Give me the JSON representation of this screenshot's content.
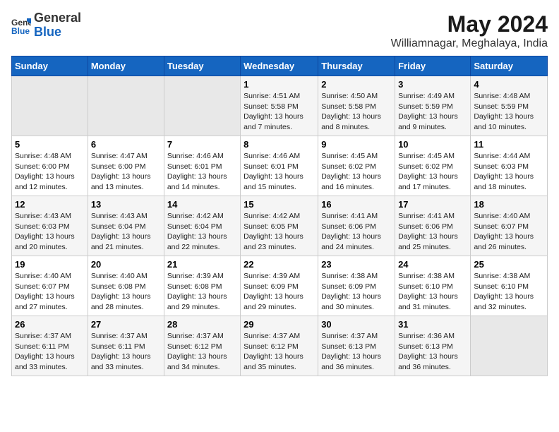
{
  "logo": {
    "text_general": "General",
    "text_blue": "Blue"
  },
  "title": "May 2024",
  "subtitle": "Williamnagar, Meghalaya, India",
  "days_of_week": [
    "Sunday",
    "Monday",
    "Tuesday",
    "Wednesday",
    "Thursday",
    "Friday",
    "Saturday"
  ],
  "weeks": [
    [
      {
        "day": "",
        "sunrise": "",
        "sunset": "",
        "daylight": "",
        "empty": true
      },
      {
        "day": "",
        "sunrise": "",
        "sunset": "",
        "daylight": "",
        "empty": true
      },
      {
        "day": "",
        "sunrise": "",
        "sunset": "",
        "daylight": "",
        "empty": true
      },
      {
        "day": "1",
        "sunrise": "Sunrise: 4:51 AM",
        "sunset": "Sunset: 5:58 PM",
        "daylight": "Daylight: 13 hours and 7 minutes."
      },
      {
        "day": "2",
        "sunrise": "Sunrise: 4:50 AM",
        "sunset": "Sunset: 5:58 PM",
        "daylight": "Daylight: 13 hours and 8 minutes."
      },
      {
        "day": "3",
        "sunrise": "Sunrise: 4:49 AM",
        "sunset": "Sunset: 5:59 PM",
        "daylight": "Daylight: 13 hours and 9 minutes."
      },
      {
        "day": "4",
        "sunrise": "Sunrise: 4:48 AM",
        "sunset": "Sunset: 5:59 PM",
        "daylight": "Daylight: 13 hours and 10 minutes."
      }
    ],
    [
      {
        "day": "5",
        "sunrise": "Sunrise: 4:48 AM",
        "sunset": "Sunset: 6:00 PM",
        "daylight": "Daylight: 13 hours and 12 minutes."
      },
      {
        "day": "6",
        "sunrise": "Sunrise: 4:47 AM",
        "sunset": "Sunset: 6:00 PM",
        "daylight": "Daylight: 13 hours and 13 minutes."
      },
      {
        "day": "7",
        "sunrise": "Sunrise: 4:46 AM",
        "sunset": "Sunset: 6:01 PM",
        "daylight": "Daylight: 13 hours and 14 minutes."
      },
      {
        "day": "8",
        "sunrise": "Sunrise: 4:46 AM",
        "sunset": "Sunset: 6:01 PM",
        "daylight": "Daylight: 13 hours and 15 minutes."
      },
      {
        "day": "9",
        "sunrise": "Sunrise: 4:45 AM",
        "sunset": "Sunset: 6:02 PM",
        "daylight": "Daylight: 13 hours and 16 minutes."
      },
      {
        "day": "10",
        "sunrise": "Sunrise: 4:45 AM",
        "sunset": "Sunset: 6:02 PM",
        "daylight": "Daylight: 13 hours and 17 minutes."
      },
      {
        "day": "11",
        "sunrise": "Sunrise: 4:44 AM",
        "sunset": "Sunset: 6:03 PM",
        "daylight": "Daylight: 13 hours and 18 minutes."
      }
    ],
    [
      {
        "day": "12",
        "sunrise": "Sunrise: 4:43 AM",
        "sunset": "Sunset: 6:03 PM",
        "daylight": "Daylight: 13 hours and 20 minutes."
      },
      {
        "day": "13",
        "sunrise": "Sunrise: 4:43 AM",
        "sunset": "Sunset: 6:04 PM",
        "daylight": "Daylight: 13 hours and 21 minutes."
      },
      {
        "day": "14",
        "sunrise": "Sunrise: 4:42 AM",
        "sunset": "Sunset: 6:04 PM",
        "daylight": "Daylight: 13 hours and 22 minutes."
      },
      {
        "day": "15",
        "sunrise": "Sunrise: 4:42 AM",
        "sunset": "Sunset: 6:05 PM",
        "daylight": "Daylight: 13 hours and 23 minutes."
      },
      {
        "day": "16",
        "sunrise": "Sunrise: 4:41 AM",
        "sunset": "Sunset: 6:06 PM",
        "daylight": "Daylight: 13 hours and 24 minutes."
      },
      {
        "day": "17",
        "sunrise": "Sunrise: 4:41 AM",
        "sunset": "Sunset: 6:06 PM",
        "daylight": "Daylight: 13 hours and 25 minutes."
      },
      {
        "day": "18",
        "sunrise": "Sunrise: 4:40 AM",
        "sunset": "Sunset: 6:07 PM",
        "daylight": "Daylight: 13 hours and 26 minutes."
      }
    ],
    [
      {
        "day": "19",
        "sunrise": "Sunrise: 4:40 AM",
        "sunset": "Sunset: 6:07 PM",
        "daylight": "Daylight: 13 hours and 27 minutes."
      },
      {
        "day": "20",
        "sunrise": "Sunrise: 4:40 AM",
        "sunset": "Sunset: 6:08 PM",
        "daylight": "Daylight: 13 hours and 28 minutes."
      },
      {
        "day": "21",
        "sunrise": "Sunrise: 4:39 AM",
        "sunset": "Sunset: 6:08 PM",
        "daylight": "Daylight: 13 hours and 29 minutes."
      },
      {
        "day": "22",
        "sunrise": "Sunrise: 4:39 AM",
        "sunset": "Sunset: 6:09 PM",
        "daylight": "Daylight: 13 hours and 29 minutes."
      },
      {
        "day": "23",
        "sunrise": "Sunrise: 4:38 AM",
        "sunset": "Sunset: 6:09 PM",
        "daylight": "Daylight: 13 hours and 30 minutes."
      },
      {
        "day": "24",
        "sunrise": "Sunrise: 4:38 AM",
        "sunset": "Sunset: 6:10 PM",
        "daylight": "Daylight: 13 hours and 31 minutes."
      },
      {
        "day": "25",
        "sunrise": "Sunrise: 4:38 AM",
        "sunset": "Sunset: 6:10 PM",
        "daylight": "Daylight: 13 hours and 32 minutes."
      }
    ],
    [
      {
        "day": "26",
        "sunrise": "Sunrise: 4:37 AM",
        "sunset": "Sunset: 6:11 PM",
        "daylight": "Daylight: 13 hours and 33 minutes."
      },
      {
        "day": "27",
        "sunrise": "Sunrise: 4:37 AM",
        "sunset": "Sunset: 6:11 PM",
        "daylight": "Daylight: 13 hours and 33 minutes."
      },
      {
        "day": "28",
        "sunrise": "Sunrise: 4:37 AM",
        "sunset": "Sunset: 6:12 PM",
        "daylight": "Daylight: 13 hours and 34 minutes."
      },
      {
        "day": "29",
        "sunrise": "Sunrise: 4:37 AM",
        "sunset": "Sunset: 6:12 PM",
        "daylight": "Daylight: 13 hours and 35 minutes."
      },
      {
        "day": "30",
        "sunrise": "Sunrise: 4:37 AM",
        "sunset": "Sunset: 6:13 PM",
        "daylight": "Daylight: 13 hours and 36 minutes."
      },
      {
        "day": "31",
        "sunrise": "Sunrise: 4:36 AM",
        "sunset": "Sunset: 6:13 PM",
        "daylight": "Daylight: 13 hours and 36 minutes."
      },
      {
        "day": "",
        "sunrise": "",
        "sunset": "",
        "daylight": "",
        "empty": true
      }
    ]
  ]
}
